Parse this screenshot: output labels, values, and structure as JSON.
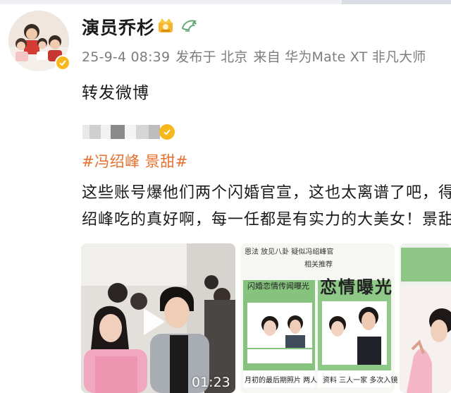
{
  "post": {
    "username": "演员乔杉",
    "meta": {
      "timestamp": "25-9-4 08:39",
      "published_at": "发布于 北京",
      "source": "来自 华为Mate XT 非凡大师"
    },
    "repost_text": "转发微博"
  },
  "original": {
    "hashtag": "#冯绍峰 景甜#",
    "line1": "这些账号爆他们两个闪婚官宣，这也太离谱了吧，得",
    "line2": "绍峰吃的真好啊，每一任都是有实力的大美女！景甜"
  },
  "media": {
    "video_duration": "01:23",
    "image2": {
      "top_text": "恩法  放见八卦  疑似冯绍峰官",
      "sub_text": "相关推荐",
      "left_title": "闪婚恋情传闻曝光",
      "big_title": "恋情曝光",
      "caption_left": "月初的最后期照片 两人",
      "caption_right": "资料 三人一家 多次入镜"
    }
  },
  "colors": {
    "hashtag": "#e86f2d",
    "meta": "#7d7d7d",
    "verify": "#f7b81e"
  }
}
